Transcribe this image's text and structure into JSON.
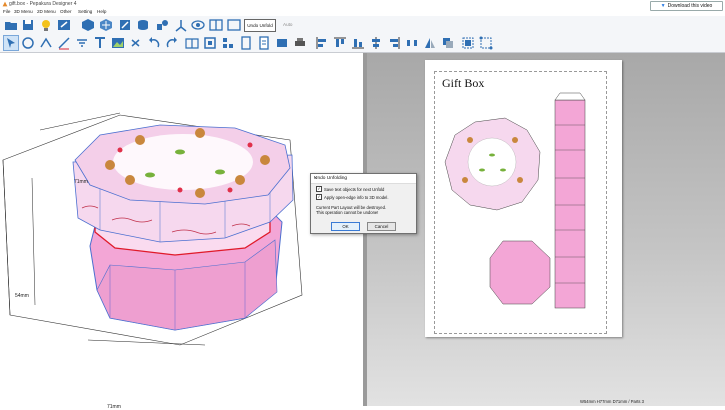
{
  "window": {
    "title": "gift.box - Pepakura Designer 4",
    "download_label": "Download this video"
  },
  "menu": [
    "File",
    "3D Menu",
    "2D Menu",
    "Other",
    "Setting",
    "Help"
  ],
  "toolbar": {
    "undo_unfold_label": "Undo Unfold",
    "auto_label": "Auto"
  },
  "view3d": {
    "dim_top": "71mm",
    "dim_side": "54mm",
    "dim_bottom": "71mm"
  },
  "view2d": {
    "paper_title": "Gift Box"
  },
  "dialog": {
    "title": "Undo Unfolding",
    "option1": "Save text objects for next Unfold",
    "option2": "Apply open-edge info to 3D model.",
    "warning_line1": "Current Part Layout will be destroyed.",
    "warning_line2": "This operation cannot be undone!",
    "ok_label": "OK",
    "cancel_label": "Cancel"
  },
  "status": {
    "text": "W54mm H77mm D71mm / Parts 3"
  },
  "colors": {
    "pink": "#f3a6d6",
    "lid": "#f6d8ee",
    "accent": "#3a7bd5"
  }
}
